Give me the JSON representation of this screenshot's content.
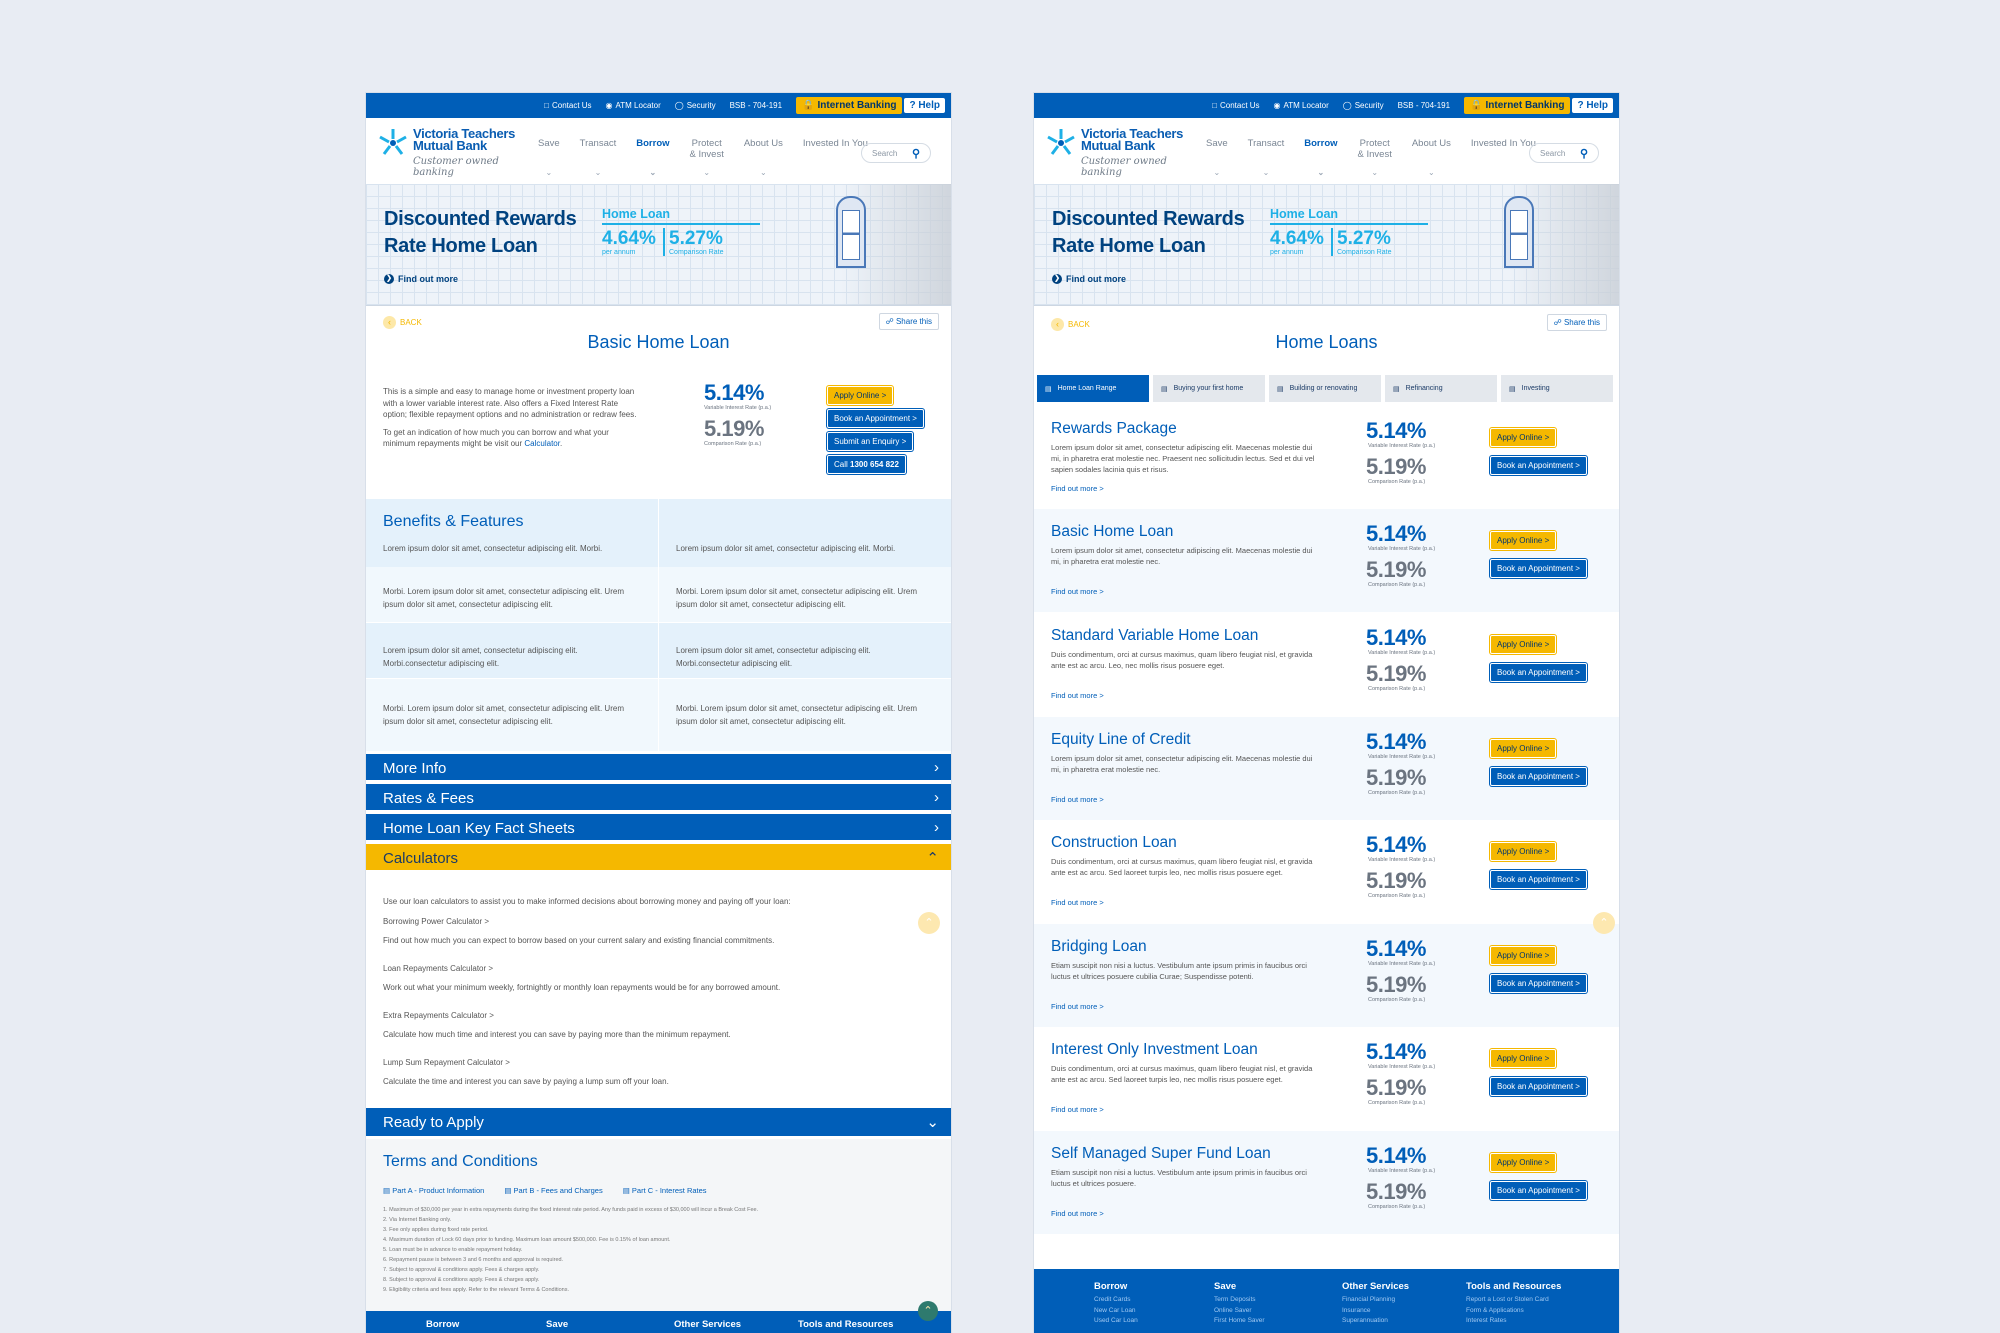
{
  "utility": {
    "contact": "Contact Us",
    "atm": "ATM Locator",
    "security": "Security",
    "bsb": "BSB - 704-191",
    "internet_banking": "Internet Banking",
    "help": "Help"
  },
  "header": {
    "brand_line1": "Victoria Teachers",
    "brand_line2": "Mutual Bank",
    "tagline": "Customer owned banking",
    "nav": [
      "Save",
      "Transact",
      "Borrow",
      "Protect\n& Invest",
      "About Us",
      "Invested In You"
    ],
    "search_placeholder": "Search"
  },
  "hero": {
    "title_line1": "Discounted Rewards",
    "title_line2": "Rate Home Loan",
    "find_out": "Find out more",
    "product": "Home Loan",
    "rate1": "4.64%",
    "rate1_label": "per annum",
    "rate2": "5.27%",
    "rate2_label": "Comparison Rate"
  },
  "common": {
    "back": "BACK",
    "share": "Share this",
    "var_rate": "5.14%",
    "var_label": "Variable Interest Rate (p.a.)",
    "comp_rate": "5.19%",
    "comp_label": "Comparison Rate (p.a.)",
    "apply": "Apply Online >",
    "book": "Book an Appointment >",
    "find_more": "Find out more >"
  },
  "left": {
    "title": "Basic Home Loan",
    "intro1": "This is a  simple and easy to manage home or investment property loan with a lower variable interest rate. Also offers a Fixed Interest Rate option; flexible repayment options and no administration or redraw fees.",
    "intro2": "To get an indication of how much you can borrow and what your minimum repayments might be visit our",
    "intro_link": "Calculator",
    "enquiry": "Submit an Enquiry >",
    "call_prefix": "Call ",
    "call_number": "1300 654 822",
    "benefits_title": "Benefits & Features",
    "benefits": [
      "Lorem ipsum dolor sit amet, consectetur adipiscing elit. Morbi.",
      "Lorem ipsum dolor sit amet, consectetur adipiscing elit. Morbi.",
      "Morbi. Lorem ipsum dolor sit amet, consectetur adipiscing elit. Urem ipsum dolor sit amet, consectetur adipiscing elit.",
      "Morbi. Lorem ipsum dolor sit amet, consectetur adipiscing elit. Urem ipsum dolor sit amet, consectetur adipiscing elit.",
      "Lorem ipsum dolor sit amet, consectetur adipiscing elit. Morbi.consectetur adipiscing elit.",
      "Lorem ipsum dolor sit amet, consectetur adipiscing elit. Morbi.consectetur adipiscing elit.",
      "Morbi. Lorem ipsum dolor sit amet, consectetur adipiscing elit. Urem ipsum dolor sit amet, consectetur adipiscing elit.",
      "Morbi. Lorem ipsum dolor sit amet, consectetur adipiscing elit. Urem ipsum dolor sit amet, consectetur adipiscing elit."
    ],
    "accordions": [
      "More Info",
      "Rates & Fees",
      "Home Loan Key Fact Sheets",
      "Calculators"
    ],
    "calc_intro": "Use our loan calculators to assist you to make informed decisions about borrowing money and paying off your loan:",
    "calculators": [
      {
        "link": "Borrowing Power Calculator >",
        "desc": "Find out how much you can expect to borrow based on your current salary and existing financial commitments."
      },
      {
        "link": "Loan Repayments Calculator >",
        "desc": "Work out what your minimum weekly, fortnightly or monthly loan repayments would be for any borrowed amount."
      },
      {
        "link": "Extra Repayments Calculator >",
        "desc": "Calculate how much time and interest you can save by paying more than the minimum repayment."
      },
      {
        "link": "Lump Sum Repayment Calculator >",
        "desc": "Calculate the time and interest you can save by paying a lump sum off your loan."
      }
    ],
    "ready": "Ready to Apply",
    "terms_title": "Terms and Conditions",
    "term_links": [
      "Part A - Product Information",
      "Part B - Fees and Charges",
      "Part C - Interest Rates"
    ],
    "terms": [
      "1.  Maximum of $30,000 per year in extra repayments during the fixed interest rate period. Any funds paid in excess of $30,000 will incur a Break Cost Fee.",
      "2.  Via Internet Banking only.",
      "3.  Fee only applies during fixed rate period.",
      "4.  Maximum duration of Lock 60 days prior to funding. Maximum loan amount $500,000. Fee is 0.15% of loan amount.",
      "5.  Loan must be in advance to enable repayment holiday.",
      "6.  Repayment pause is between 3 and 6 months and approval is required.",
      "7.  Subject to approval & conditions apply. Fees & charges apply.",
      "8.  Subject to approval & conditions apply. Fees & charges apply.",
      "9.  Eligibility criteria and fees apply. Refer to the relevant Terms & Conditions."
    ],
    "footer": [
      "Borrow",
      "Save",
      "Other Services",
      "Tools and Resources"
    ]
  },
  "right": {
    "title": "Home Loans",
    "tabs": [
      "Home Loan Range",
      "Buying your first home",
      "Building or renovating",
      "Refinancing",
      "Investing"
    ],
    "products": [
      {
        "name": "Rewards Package",
        "desc": "Lorem ipsum dolor sit amet, consectetur adipiscing elit. Maecenas molestie dui mi, in pharetra erat molestie nec. Praesent nec sollicitudin lectus. Sed et dui vel sapien sodales lacinia quis et risus."
      },
      {
        "name": "Basic Home Loan",
        "desc": "Lorem ipsum dolor sit amet, consectetur adipiscing elit. Maecenas molestie dui mi, in pharetra erat molestie nec."
      },
      {
        "name": "Standard Variable Home Loan",
        "desc": "Duis condimentum, orci at cursus maximus, quam libero feugiat nisl, et gravida ante est ac arcu. Leo, nec mollis risus posuere eget."
      },
      {
        "name": "Equity Line of Credit",
        "desc": "Lorem ipsum dolor sit amet, consectetur adipiscing elit. Maecenas molestie dui mi, in pharetra erat molestie nec."
      },
      {
        "name": "Construction Loan",
        "desc": "Duis condimentum, orci at cursus maximus, quam libero feugiat nisl, et gravida ante est ac arcu. Sed laoreet turpis leo, nec mollis risus posuere eget."
      },
      {
        "name": "Bridging Loan",
        "desc": "Etiam suscipit non nisi a luctus. Vestibulum ante ipsum primis in faucibus orci luctus et ultrices posuere cubilia Curae; Suspendisse potenti."
      },
      {
        "name": "Interest Only Investment Loan",
        "desc": "Duis condimentum, orci at cursus maximus, quam libero feugiat nisl, et gravida ante est ac arcu. Sed laoreet turpis leo, nec mollis risus posuere eget."
      },
      {
        "name": "Self Managed Super Fund Loan",
        "desc": "Etiam suscipit non nisi a luctus. Vestibulum ante ipsum primis in faucibus orci luctus et ultrices posuere."
      }
    ],
    "footer": [
      {
        "title": "Borrow",
        "links": [
          "Credit Cards",
          "New Car Loan",
          "Used Car Loan"
        ]
      },
      {
        "title": "Save",
        "links": [
          "Term Deposits",
          "Online Saver",
          "First Home Saver"
        ]
      },
      {
        "title": "Other Services",
        "links": [
          "Financial Planning",
          "Insurance",
          "Superannuation"
        ]
      },
      {
        "title": "Tools and Resources",
        "links": [
          "Report a Lost or Stolen Card",
          "Form & Applications",
          "Interest Rates"
        ]
      }
    ]
  }
}
